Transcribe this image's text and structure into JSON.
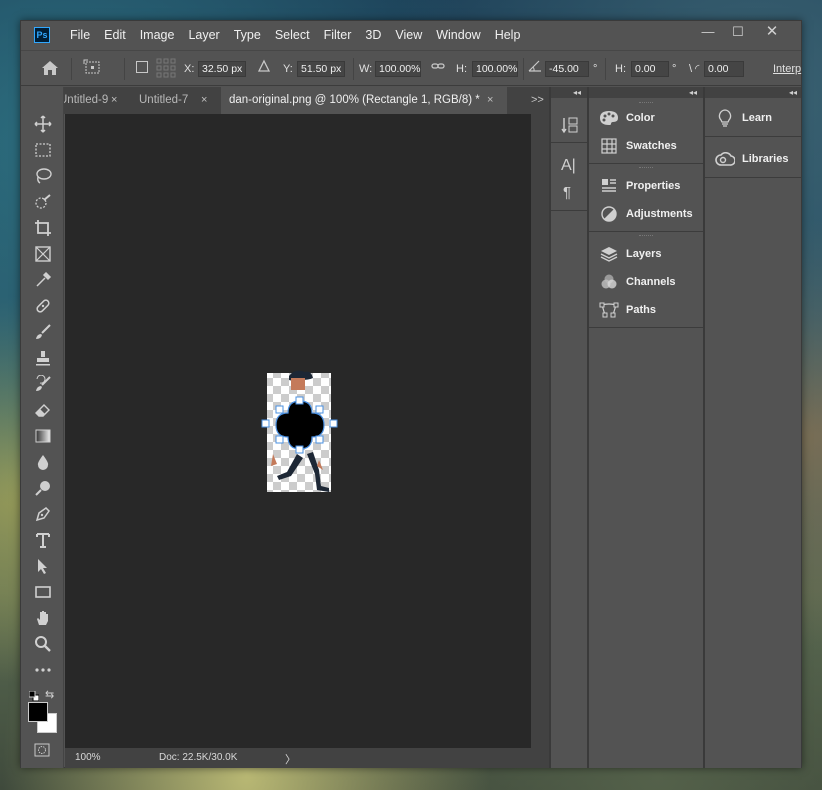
{
  "app": {
    "logo_text": "Ps",
    "menu": [
      "File",
      "Edit",
      "Image",
      "Layer",
      "Type",
      "Select",
      "Filter",
      "3D",
      "View",
      "Window",
      "Help"
    ],
    "window_controls": {
      "minimize": "—",
      "restore": "☐",
      "close": "✕"
    }
  },
  "options_bar": {
    "x_label": "X:",
    "x_value": "32.50 px",
    "y_label": "Y:",
    "y_value": "51.50 px",
    "w_label": "W:",
    "w_value": "100.00%",
    "h_label": "H:",
    "h_value": "100.00%",
    "angle_value": "-45.00",
    "angle_unit": "°",
    "hskew_label": "H:",
    "hskew_value": "0.00",
    "hskew_unit": "°",
    "vskew_value": "0.00",
    "interp_label": "Interp"
  },
  "tabs": [
    {
      "label": "Untitled-9",
      "active": false
    },
    {
      "label": "Untitled-7",
      "active": false
    },
    {
      "label": "dan-original.png @ 100% (Rectangle 1, RGB/8) *",
      "active": true
    }
  ],
  "tab_close": "×",
  "tab_overflow": ">>",
  "status": {
    "zoom": "100%",
    "doc": "Doc: 22.5K/30.0K",
    "arrow": "〉"
  },
  "panels": {
    "col2": [
      {
        "group": 1,
        "items": [
          {
            "label": "Color",
            "icon": "palette-icon"
          },
          {
            "label": "Swatches",
            "icon": "swatches-grid-icon"
          }
        ]
      },
      {
        "group": 2,
        "items": [
          {
            "label": "Properties",
            "icon": "properties-icon"
          },
          {
            "label": "Adjustments",
            "icon": "adjustments-icon"
          }
        ]
      },
      {
        "group": 3,
        "items": [
          {
            "label": "Layers",
            "icon": "layers-icon"
          },
          {
            "label": "Channels",
            "icon": "channels-icon"
          },
          {
            "label": "Paths",
            "icon": "paths-icon"
          }
        ]
      }
    ],
    "col3": [
      {
        "label": "Learn",
        "icon": "lightbulb-icon"
      },
      {
        "label": "Libraries",
        "icon": "creative-cloud-libraries-icon"
      }
    ],
    "collapse_glyph": "◂◂",
    "expand_glyph": "▸▸"
  },
  "colors": {
    "foreground": "#000000",
    "background": "#ffffff",
    "ps_blue": "#31a8ff",
    "shape_outline": "#4a90e2"
  }
}
